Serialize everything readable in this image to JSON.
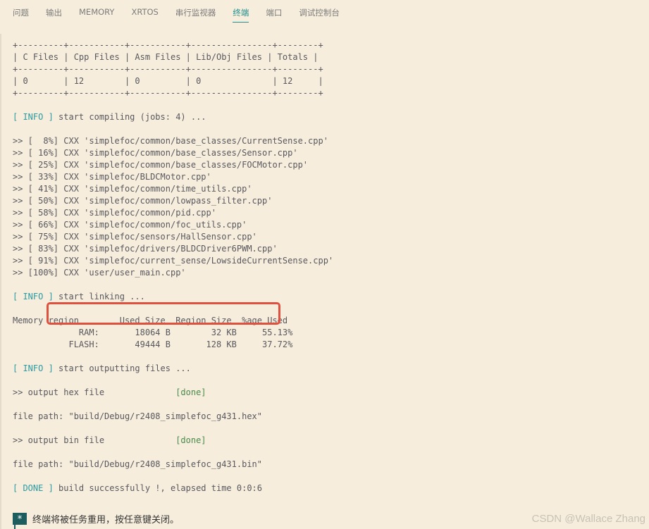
{
  "tabs": [
    {
      "label": "问题"
    },
    {
      "label": "输出"
    },
    {
      "label": "MEMORY"
    },
    {
      "label": "XRTOS"
    },
    {
      "label": "串行监视器"
    },
    {
      "label": "终端"
    },
    {
      "label": "端口"
    },
    {
      "label": "调试控制台"
    }
  ],
  "active_tab": "终端",
  "terminal": {
    "table": {
      "border": "+---------+-----------+-----------+----------------+--------+",
      "header": "| C Files | Cpp Files | Asm Files | Lib/Obj Files | Totals |",
      "row": "| 0       | 12        | 0         | 0              | 12     |"
    },
    "compile": {
      "tag": "[ INFO ]",
      "message": " start compiling (jobs: 4) ..."
    },
    "files": [
      ">> [  8%] CXX 'simplefoc/common/base_classes/CurrentSense.cpp'",
      ">> [ 16%] CXX 'simplefoc/common/base_classes/Sensor.cpp'",
      ">> [ 25%] CXX 'simplefoc/common/base_classes/FOCMotor.cpp'",
      ">> [ 33%] CXX 'simplefoc/BLDCMotor.cpp'",
      ">> [ 41%] CXX 'simplefoc/common/time_utils.cpp'",
      ">> [ 50%] CXX 'simplefoc/common/lowpass_filter.cpp'",
      ">> [ 58%] CXX 'simplefoc/common/pid.cpp'",
      ">> [ 66%] CXX 'simplefoc/common/foc_utils.cpp'",
      ">> [ 75%] CXX 'simplefoc/sensors/HallSensor.cpp'",
      ">> [ 83%] CXX 'simplefoc/drivers/BLDCDriver6PWM.cpp'",
      ">> [ 91%] CXX 'simplefoc/current_sense/LowsideCurrentSense.cpp'",
      ">> [100%] CXX 'user/user_main.cpp'"
    ],
    "linking": {
      "tag": "[ INFO ]",
      "message": " start linking ..."
    },
    "memory": {
      "header": "Memory region        Used Size  Region Size  %age Used",
      "ram": "             RAM:       18064 B        32 KB     55.13%",
      "flash": "           FLASH:       49444 B       128 KB     37.72%"
    },
    "outputting": {
      "tag": "[ INFO ]",
      "message": " start outputting files ..."
    },
    "hex": {
      "label": ">> output hex file              ",
      "status": "[done]",
      "path": "file path: \"build/Debug/r2408_simplefoc_g431.hex\""
    },
    "bin": {
      "label": ">> output bin file              ",
      "status": "[done]",
      "path": "file path: \"build/Debug/r2408_simplefoc_g431.bin\""
    },
    "done": {
      "tag": "[ DONE ]",
      "message": " build successfully !, elapsed time 0:0:6"
    }
  },
  "prompt": {
    "badge": "*",
    "text": "终端将被任务重用，按任意键关闭。"
  },
  "watermark": "CSDN @Wallace Zhang"
}
